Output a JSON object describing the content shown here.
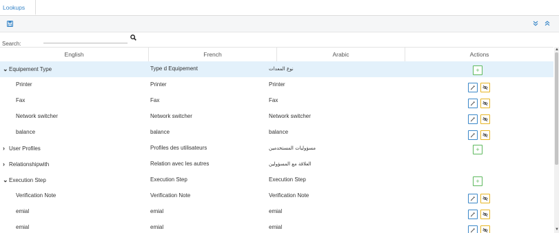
{
  "tab": {
    "label": "Lookups"
  },
  "search": {
    "label": "Search:",
    "value": "",
    "placeholder": ""
  },
  "columns": [
    "English",
    "French",
    "Arabic",
    "Actions"
  ],
  "colors": {
    "accent": "#3a87c8",
    "add": "#5cb85c",
    "hide": "#e6b422",
    "selected_row": "#e3f1fb"
  },
  "rows": [
    {
      "level": 0,
      "expanded": true,
      "english": "Equipement Type",
      "french": "Type d Equipement",
      "arabic": "نوع المعدات",
      "actions": "add",
      "selected": true
    },
    {
      "level": 1,
      "english": "Printer",
      "french": "Printer",
      "arabic": "Printer",
      "actions": "edit-hide"
    },
    {
      "level": 1,
      "english": "Fax",
      "french": "Fax",
      "arabic": "Fax",
      "actions": "edit-hide"
    },
    {
      "level": 1,
      "english": "Network switcher",
      "french": "Network switcher",
      "arabic": "Network switcher",
      "actions": "edit-hide"
    },
    {
      "level": 1,
      "english": "balance",
      "french": "balance",
      "arabic": "balance",
      "actions": "edit-hide"
    },
    {
      "level": 0,
      "expanded": false,
      "english": "User Profiles",
      "french": "Profiles des utilisateurs",
      "arabic": "مسؤوليات المستخدمين",
      "actions": "add"
    },
    {
      "level": 0,
      "expanded": false,
      "english": "Relationshipwith",
      "french": "Relation avec les autres",
      "arabic": "العلاقة مع المسؤولين",
      "actions": "none"
    },
    {
      "level": 0,
      "expanded": true,
      "english": "Execution Step",
      "french": "Execution Step",
      "arabic": "Execution Step",
      "actions": "add"
    },
    {
      "level": 1,
      "english": "Verification Note",
      "french": "Verification Note",
      "arabic": "Verification Note",
      "actions": "edit-hide"
    },
    {
      "level": 1,
      "english": "emial",
      "french": "emial",
      "arabic": "emial",
      "actions": "edit-hide"
    },
    {
      "level": 1,
      "english": "emial",
      "french": "emial",
      "arabic": "emial",
      "actions": "edit-hide"
    }
  ]
}
